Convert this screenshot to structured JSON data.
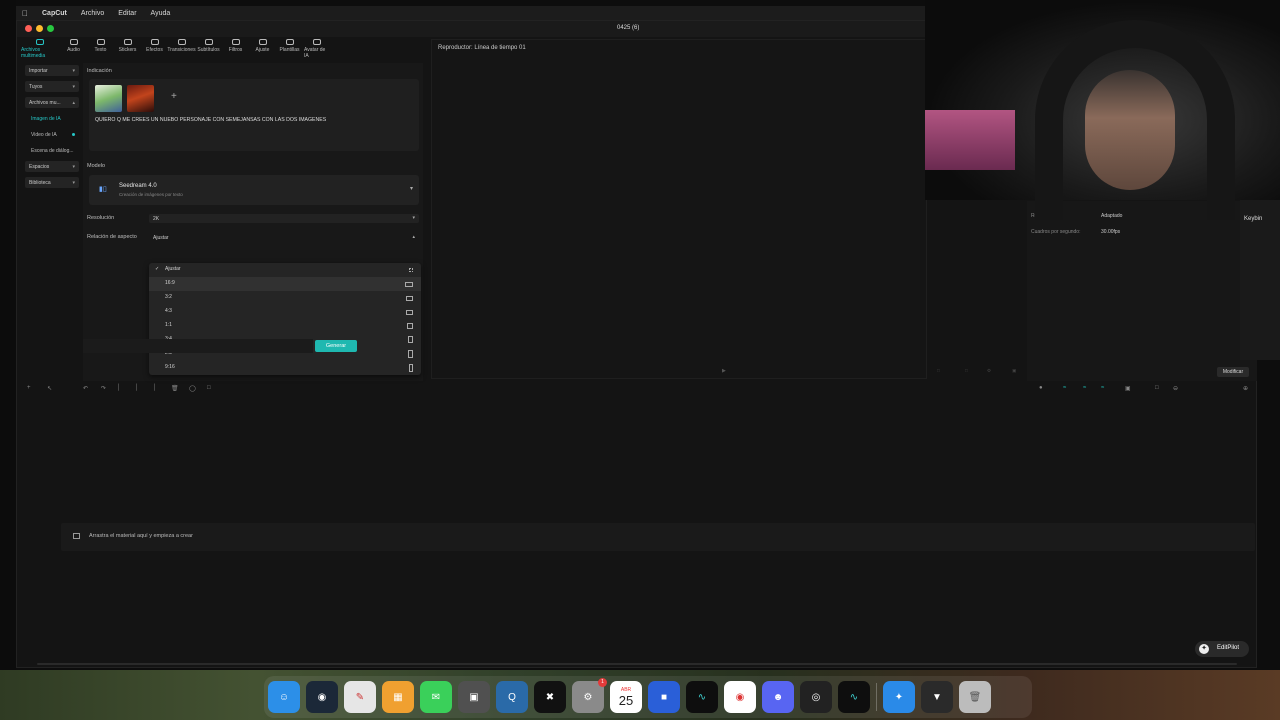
{
  "menubar": {
    "apple": "",
    "app_name": "CapCut",
    "items": [
      "Archivo",
      "Editar",
      "Ayuda"
    ]
  },
  "window": {
    "title": "0425 (6)"
  },
  "toolbar": {
    "tabs": [
      {
        "label": "Archivos multimedia",
        "icon": "media-icon"
      },
      {
        "label": "Audio",
        "icon": "audio-icon"
      },
      {
        "label": "Texto",
        "icon": "text-icon"
      },
      {
        "label": "Stickers",
        "icon": "sticker-icon"
      },
      {
        "label": "Efectos",
        "icon": "effects-icon"
      },
      {
        "label": "Transiciones",
        "icon": "transitions-icon"
      },
      {
        "label": "Subtítulos",
        "icon": "subtitles-icon"
      },
      {
        "label": "Filtros",
        "icon": "filters-icon"
      },
      {
        "label": "Ajuste",
        "icon": "adjust-icon"
      },
      {
        "label": "Plantillas",
        "icon": "templates-icon"
      },
      {
        "label": "Avatar de IA",
        "icon": "avatar-icon"
      }
    ]
  },
  "sidebar": {
    "items": [
      {
        "label": "Importar",
        "type": "group"
      },
      {
        "label": "Tuyos",
        "type": "group"
      },
      {
        "label": "Archivos mu...",
        "type": "group"
      },
      {
        "label": "Imagen de IA",
        "type": "active"
      },
      {
        "label": "Video de IA",
        "type": "sub"
      },
      {
        "label": "Escena de diálog...",
        "type": "sub"
      },
      {
        "label": "Espacios",
        "type": "group"
      },
      {
        "label": "Biblioteca",
        "type": "group"
      }
    ]
  },
  "generator": {
    "prompt_label": "Indicación",
    "prompt_text": "QUIERO Q ME CREES UN NUEBO PERSONAJE CON SEMEJANSAS CON LAS DOS IMAGENES",
    "model_label": "Modelo",
    "model_name": "Seedream 4.0",
    "model_desc": "Creación de imágenes por texto",
    "resolution_label": "Resolución",
    "resolution_value": "2K",
    "aspect_label": "Relación de aspecto",
    "aspect_value": "Ajustar",
    "aspect_options": [
      {
        "label": "Ajustar",
        "selected": true
      },
      {
        "label": "16:9",
        "selected": false
      },
      {
        "label": "3:2",
        "selected": false
      },
      {
        "label": "4:3",
        "selected": false
      },
      {
        "label": "1:1",
        "selected": false
      },
      {
        "label": "3:4",
        "selected": false
      },
      {
        "label": "2:3",
        "selected": false
      },
      {
        "label": "9:16",
        "selected": false
      }
    ],
    "generate_label": "Generar"
  },
  "player": {
    "title": "Reproductor: Línea de tiempo 01"
  },
  "details": {
    "rows": [
      {
        "label": "Relación de aspecto:",
        "value": "Original"
      },
      {
        "label": "Resolución:",
        "value": "Adaptado"
      },
      {
        "label": "Cuadros por segundo:",
        "value": "30.00fps"
      }
    ],
    "modify_label": "Modificar",
    "sliver_text": "Keybin"
  },
  "timeline": {
    "drop_text": "Arrastra el material aquí y empieza a crear"
  },
  "editpilot": {
    "label": "EditPilot"
  },
  "dock": {
    "apps": [
      {
        "name": "finder-icon",
        "color": "#2c8fe8"
      },
      {
        "name": "steam-icon",
        "color": "#1b2838"
      },
      {
        "name": "notes-icon",
        "color": "#e6e6e6"
      },
      {
        "name": "launchpad-icon",
        "color": "#f0a030"
      },
      {
        "name": "messages-icon",
        "color": "#3ad05a"
      },
      {
        "name": "screenshot-icon",
        "color": "#505050"
      },
      {
        "name": "quicktime-icon",
        "color": "#2a6aa8"
      },
      {
        "name": "capcut-icon",
        "color": "#111111"
      },
      {
        "name": "system-settings-icon",
        "color": "#8a8a8a"
      },
      {
        "name": "calendar-icon",
        "color": "#ffffff"
      },
      {
        "name": "roblox-icon",
        "color": "#2a5fd8"
      },
      {
        "name": "waves-icon",
        "color": "#0e0e0e"
      },
      {
        "name": "chrome-icon",
        "color": "#ffffff"
      },
      {
        "name": "discord-icon",
        "color": "#5865f2"
      },
      {
        "name": "obs-icon",
        "color": "#222222"
      },
      {
        "name": "waves-2-icon",
        "color": "#0e0e0e"
      },
      {
        "name": "safari-icon",
        "color": "#2a8ae8"
      },
      {
        "name": "downloads-icon",
        "color": "#2a2a2a"
      },
      {
        "name": "trash-icon",
        "color": "#bcbcbc"
      }
    ],
    "settings_badge": "1",
    "calendar_month": "ABR",
    "calendar_day": "25"
  },
  "colors": {
    "accent": "#1fb8b0"
  }
}
